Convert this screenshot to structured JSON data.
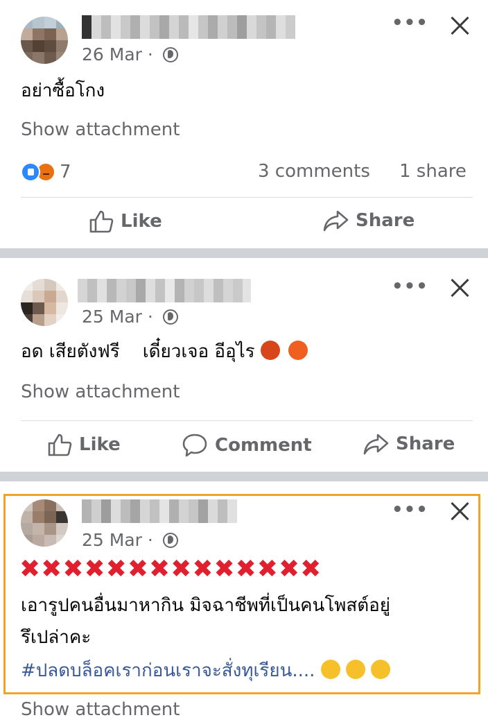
{
  "posts": [
    {
      "date": "26 Mar",
      "text": "อย่าซื้อโกง",
      "attachment": "Show attachment",
      "reaction_count": "7",
      "comments": "3 comments",
      "shares": "1 share",
      "actions": {
        "like": "Like",
        "share": "Share"
      }
    },
    {
      "date": "25 Mar",
      "text": "อด เสียตังฟรี    เดี๋ยวเจอ อีอุไร",
      "attachment": "Show attachment",
      "actions": {
        "like": "Like",
        "comment": "Comment",
        "share": "Share"
      }
    },
    {
      "date": "25 Mar",
      "x_marks": "✖✖✖✖✖✖✖✖✖✖✖✖✖✖",
      "text_line1": "เอารูปคนอื่นมาหากิน มิจฉาชีพที่เป็นคนโพสต์อยู่",
      "text_line2": "รึเปล่าคะ",
      "hashtag": "#ปลดบล็อคเราก่อนเราจะสั่งทุเรียน....",
      "attachment": "Show attachment"
    }
  ],
  "more_label": "•••",
  "icons": [
    "globe-icon",
    "more-icon",
    "close-icon",
    "like-icon",
    "share-icon",
    "comment-icon",
    "like-reaction-icon",
    "angry-reaction-icon"
  ],
  "colors": {
    "highlight": "#f0a52a",
    "hashtag": "#385898",
    "x_marks": "#e0202f",
    "separator": "#cfd2d6"
  }
}
